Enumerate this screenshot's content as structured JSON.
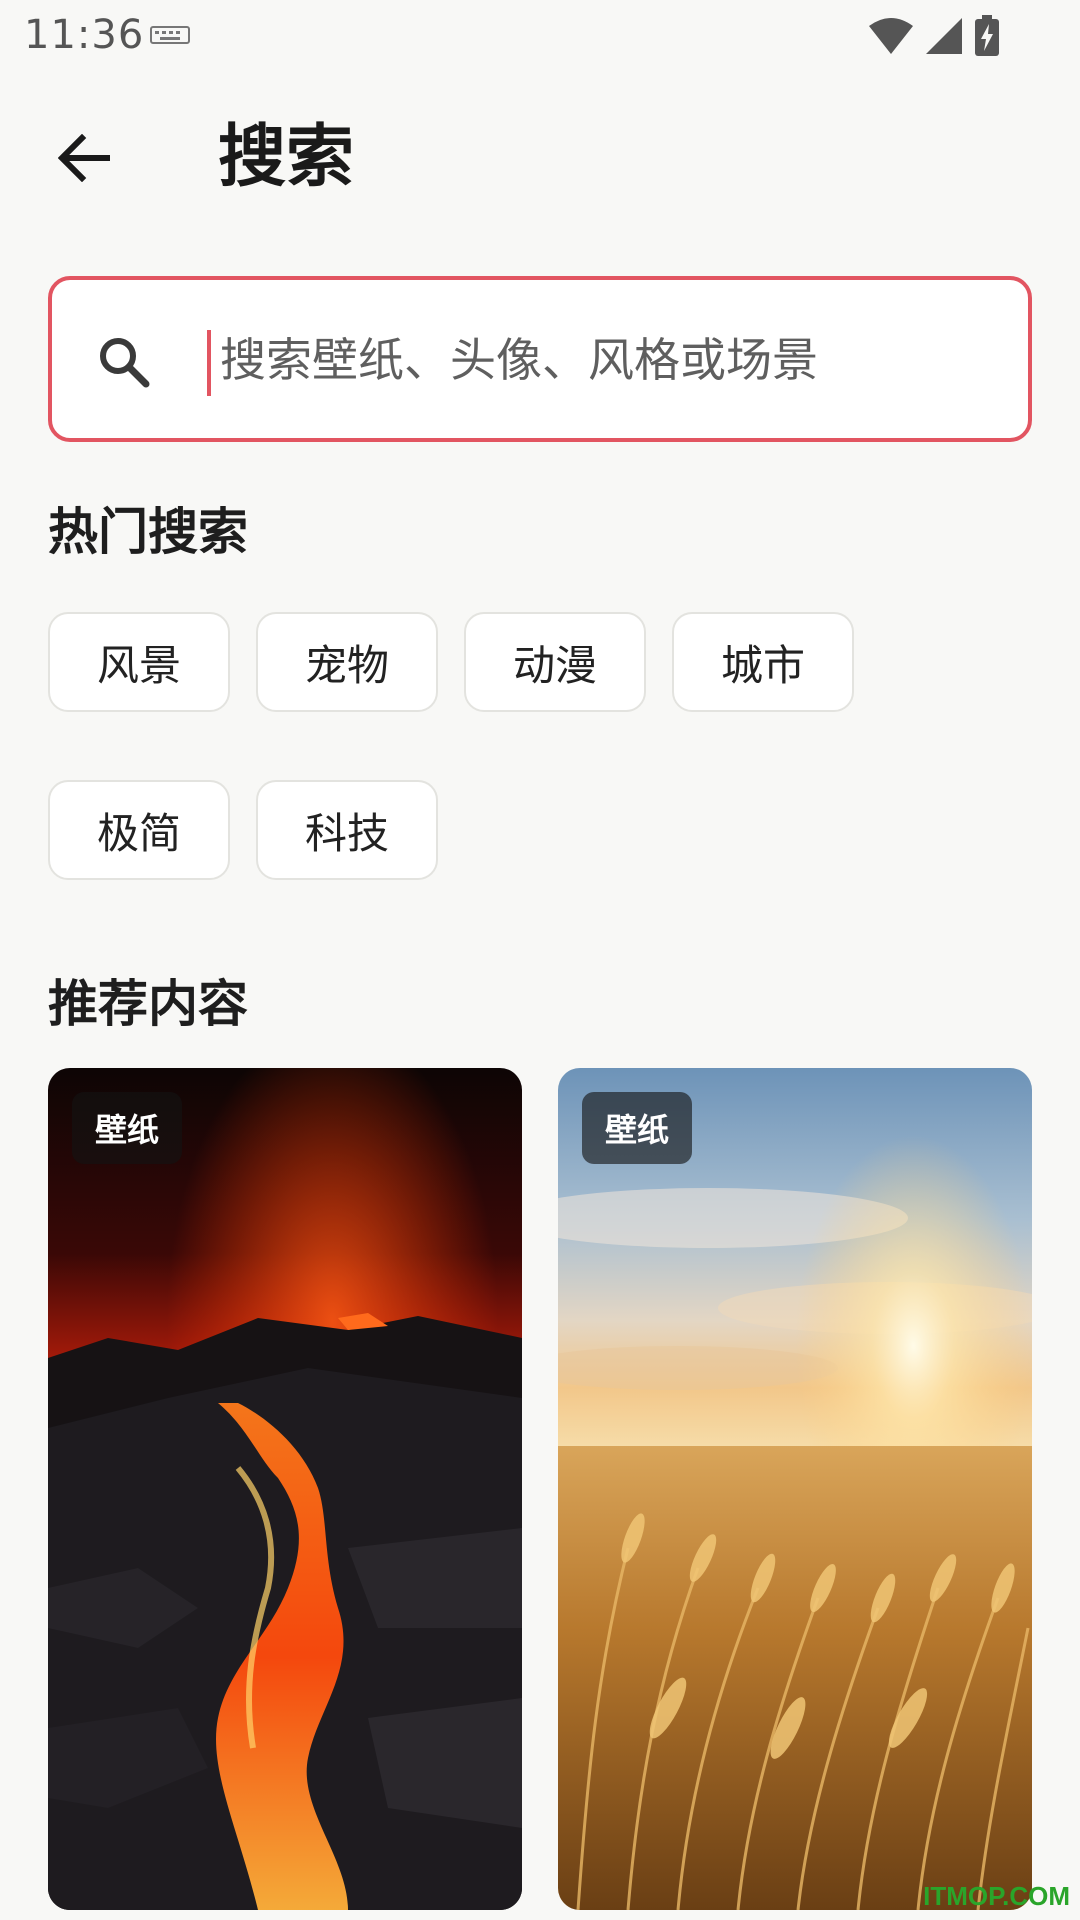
{
  "status_bar": {
    "time": "11:36"
  },
  "header": {
    "title": "搜索"
  },
  "search": {
    "placeholder": "搜索壁纸、头像、风格或场景"
  },
  "hot_search": {
    "title": "热门搜索",
    "chips": [
      "风景",
      "宠物",
      "动漫",
      "城市",
      "极简",
      "科技"
    ]
  },
  "recommend": {
    "title": "推荐内容",
    "cards": [
      {
        "badge": "壁纸",
        "image": "lava-landscape"
      },
      {
        "badge": "壁纸",
        "image": "wheat-field-sunset"
      }
    ]
  },
  "watermark": "ITMOP.COM",
  "colors": {
    "accent": "#e25561",
    "background": "#f8f8f6"
  }
}
